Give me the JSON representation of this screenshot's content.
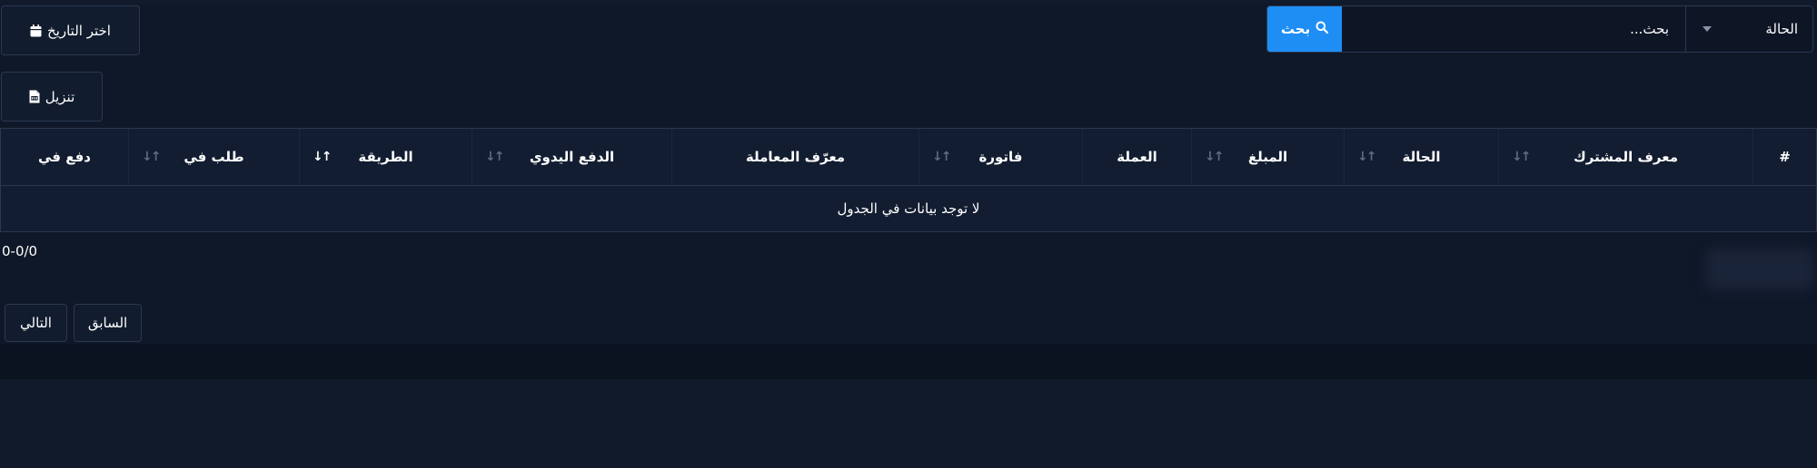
{
  "toolbar": {
    "date_picker_label": "اختر التاريخ",
    "download_label": "تنزيل"
  },
  "filter": {
    "status_label": "الحالة",
    "search_placeholder": "بحث...",
    "search_button_label": "بحث"
  },
  "table": {
    "columns": [
      {
        "label": "#",
        "sortable": false,
        "active": false
      },
      {
        "label": "معرف المشترك",
        "sortable": true,
        "active": false
      },
      {
        "label": "الحالة",
        "sortable": true,
        "active": false
      },
      {
        "label": "المبلغ",
        "sortable": true,
        "active": false
      },
      {
        "label": "العملة",
        "sortable": false,
        "active": false
      },
      {
        "label": "فاتورة",
        "sortable": true,
        "active": false
      },
      {
        "label": "معرّف المعاملة",
        "sortable": false,
        "active": false
      },
      {
        "label": "الدفع اليدوي",
        "sortable": true,
        "active": false
      },
      {
        "label": "الطريقة",
        "sortable": true,
        "active": true
      },
      {
        "label": "طلب في",
        "sortable": true,
        "active": false
      },
      {
        "label": "دفع في",
        "sortable": false,
        "active": false
      }
    ],
    "empty_message": "لا توجد بيانات في الجدول"
  },
  "pagination": {
    "range_text": "0-0/0",
    "previous_label": "السابق",
    "next_label": "التالي"
  },
  "colors": {
    "accent": "#1e8ef5",
    "background": "#0f1829",
    "border": "#2a3850"
  }
}
